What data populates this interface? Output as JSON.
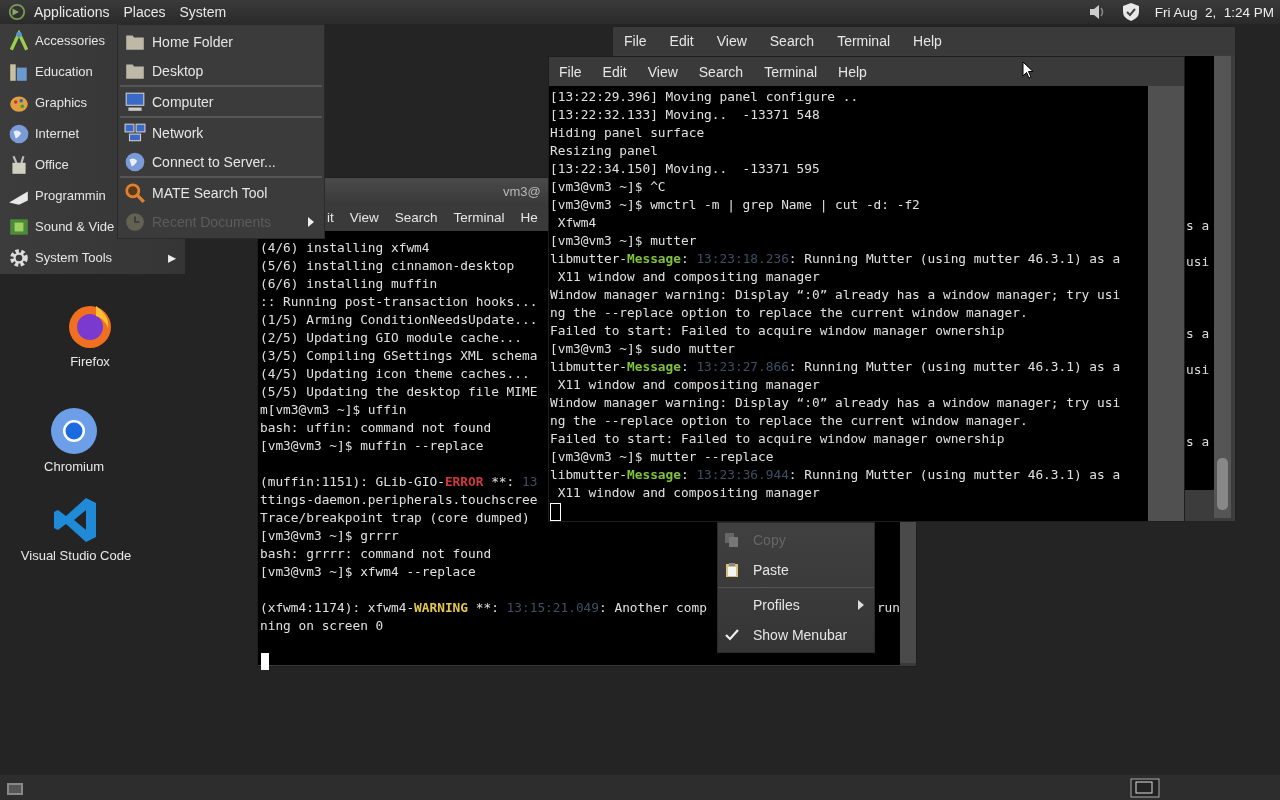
{
  "top_panel": {
    "menus": [
      "Applications",
      "Places",
      "System"
    ],
    "clock": "Fri Aug  2,  1:24 PM"
  },
  "applications_menu": {
    "items": [
      {
        "label": "Accessories"
      },
      {
        "label": "Education"
      },
      {
        "label": "Graphics"
      },
      {
        "label": "Internet"
      },
      {
        "label": "Office"
      },
      {
        "label": "Programmin"
      },
      {
        "label": "Sound & Vide"
      },
      {
        "label": "System Tools",
        "arrow": "▸"
      }
    ]
  },
  "places_menu": {
    "sections": [
      [
        {
          "label": "Home Folder",
          "disabled": false,
          "submenu": false
        },
        {
          "label": "Desktop",
          "disabled": false,
          "submenu": false
        }
      ],
      [
        {
          "label": "Computer",
          "disabled": false,
          "submenu": false
        }
      ],
      [
        {
          "label": "Network",
          "disabled": false,
          "submenu": false
        },
        {
          "label": "Connect to Server...",
          "disabled": false,
          "submenu": false
        }
      ],
      [
        {
          "label": "MATE Search Tool",
          "disabled": false,
          "submenu": false
        },
        {
          "label": "Recent Documents",
          "disabled": true,
          "submenu": true
        }
      ]
    ]
  },
  "desktop_icons": [
    {
      "label": "Firefox"
    },
    {
      "label": "Chromium"
    },
    {
      "label": "Visual Studio Code"
    }
  ],
  "rear_window": {
    "menu": [
      "File",
      "Edit",
      "View",
      "Search",
      "Terminal",
      "Help"
    ],
    "fragments": [
      "s a",
      "usi",
      "s a",
      "usi",
      "s a"
    ]
  },
  "back_terminal": {
    "title": "vm3@",
    "menu": [
      "it",
      "View",
      "Search",
      "Terminal",
      "He"
    ],
    "lines": [
      {
        "text": "(4/6) installing xfwm4"
      },
      {
        "text": "(5/6) installing cinnamon-desktop"
      },
      {
        "text": "(6/6) installing muffin"
      },
      {
        "text": ":: Running post-transaction hooks..."
      },
      {
        "text": "(1/5) Arming ConditionNeedsUpdate..."
      },
      {
        "text": "(2/5) Updating GIO module cache..."
      },
      {
        "text": "(3/5) Compiling GSettings XML schema"
      },
      {
        "text": "(4/5) Updating icon theme caches..."
      },
      {
        "text": "(5/5) Updating the desktop file MIME"
      },
      {
        "text": "m[vm3@vm3 ~]$ uffin"
      },
      {
        "text": "bash: uffin: command not found"
      },
      {
        "text": "[vm3@vm3 ~]$ muffin --replace"
      },
      {
        "space_before": true,
        "segments": [
          {
            "text": "(muffin:1151): GLib-GIO-",
            "kind": "plain"
          },
          {
            "text": "ERROR",
            "kind": "error"
          },
          {
            "text": " **: ",
            "kind": "plain"
          },
          {
            "text": "13",
            "kind": "dim"
          }
        ]
      },
      {
        "text": "ttings-daemon.peripherals.touchscree"
      },
      {
        "text": "Trace/breakpoint trap (core dumped)"
      },
      {
        "text": "[vm3@vm3 ~]$ grrrr"
      },
      {
        "text": "bash: grrrr: command not found"
      },
      {
        "text": "[vm3@vm3 ~]$ xfwm4 --replace"
      },
      {
        "space_before": true,
        "segments": [
          {
            "text": "(xfwm4:1174): xfwm4-",
            "kind": "plain"
          },
          {
            "text": "WARNING",
            "kind": "warning"
          },
          {
            "text": " **: ",
            "kind": "plain"
          },
          {
            "text": "13:15:21.049",
            "kind": "dim"
          },
          {
            "text": ": Another comp",
            "kind": "plain"
          }
        ],
        "tail": "run"
      },
      {
        "text": "ning on screen 0"
      }
    ]
  },
  "front_terminal": {
    "menu": [
      "File",
      "Edit",
      "View",
      "Search",
      "Terminal",
      "Help"
    ],
    "lines": [
      {
        "text": "[13:22:29.396] Moving panel configure .."
      },
      {
        "text": "[13:22:32.133] Moving..  -13371 548"
      },
      {
        "text": "Hiding panel surface"
      },
      {
        "text": "Resizing panel"
      },
      {
        "text": "[13:22:34.150] Moving..  -13371 595"
      },
      {
        "text": "[vm3@vm3 ~]$ ^C"
      },
      {
        "text": "[vm3@vm3 ~]$ wmctrl -m | grep Name | cut -d: -f2"
      },
      {
        "text": " Xfwm4"
      },
      {
        "text": "[vm3@vm3 ~]$ mutter"
      },
      {
        "segments": [
          {
            "text": "libmutter-",
            "kind": "plain"
          },
          {
            "text": "Message",
            "kind": "message"
          },
          {
            "text": ": ",
            "kind": "plain"
          },
          {
            "text": "13:23:18.236",
            "kind": "dim"
          },
          {
            "text": ": Running Mutter (using mutter 46.3.1) as a",
            "kind": "plain"
          }
        ]
      },
      {
        "text": " X11 window and compositing manager"
      },
      {
        "text": "Window manager warning: Display “:0” already has a window manager; try usi"
      },
      {
        "text": "ng the --replace option to replace the current window manager."
      },
      {
        "text": "Failed to start: Failed to acquire window manager ownership"
      },
      {
        "text": "[vm3@vm3 ~]$ sudo mutter"
      },
      {
        "segments": [
          {
            "text": "libmutter-",
            "kind": "plain"
          },
          {
            "text": "Message",
            "kind": "message"
          },
          {
            "text": ": ",
            "kind": "plain"
          },
          {
            "text": "13:23:27.866",
            "kind": "dim"
          },
          {
            "text": ": Running Mutter (using mutter 46.3.1) as a",
            "kind": "plain"
          }
        ]
      },
      {
        "text": " X11 window and compositing manager"
      },
      {
        "text": "Window manager warning: Display “:0” already has a window manager; try usi"
      },
      {
        "text": "ng the --replace option to replace the current window manager."
      },
      {
        "text": "Failed to start: Failed to acquire window manager ownership"
      },
      {
        "text": "[vm3@vm3 ~]$ mutter --replace"
      },
      {
        "segments": [
          {
            "text": "libmutter-",
            "kind": "plain"
          },
          {
            "text": "Message",
            "kind": "message"
          },
          {
            "text": ": ",
            "kind": "plain"
          },
          {
            "text": "13:23:36.944",
            "kind": "dim"
          },
          {
            "text": ": Running Mutter (using mutter 46.3.1) as a",
            "kind": "plain"
          }
        ]
      },
      {
        "text": " X11 window and compositing manager"
      }
    ]
  },
  "context_menu": {
    "items": [
      {
        "kind": "action",
        "label": "Copy",
        "disabled": true
      },
      {
        "kind": "action",
        "label": "Paste",
        "disabled": false
      },
      {
        "kind": "separator"
      },
      {
        "kind": "submenu",
        "label": "Profiles"
      },
      {
        "kind": "check",
        "label": "Show Menubar",
        "checked": true
      }
    ]
  }
}
